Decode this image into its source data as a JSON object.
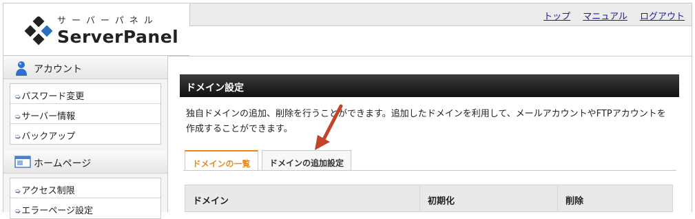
{
  "logo": {
    "kana": "サーバーパネル",
    "text": "ServerPanel"
  },
  "top_nav": [
    "トップ",
    "マニュアル",
    "ログアウト"
  ],
  "sidebar": {
    "sections": [
      {
        "title": "アカウント",
        "items": [
          "パスワード変更",
          "サーバー情報",
          "バックアップ"
        ]
      },
      {
        "title": "ホームページ",
        "items": [
          "アクセス制限",
          "エラーページ設定"
        ]
      }
    ]
  },
  "main": {
    "title": "ドメイン設定",
    "description_line1": "独自ドメインの追加、削除を行うことができます。追加したドメインを利用して、メールアカウントやFTPアカウントを",
    "description_line2": "作成することができます。",
    "tabs": [
      {
        "label": "ドメインの一覧",
        "active": true
      },
      {
        "label": "ドメインの追加設定",
        "active": false
      }
    ],
    "table": {
      "columns": [
        "ドメイン",
        "初期化",
        "削除"
      ]
    }
  },
  "colors": {
    "accent": "#e8891a",
    "title_bar": "#1f1f1f",
    "arrow": "#c0442a",
    "link": "#1a1aa6"
  }
}
